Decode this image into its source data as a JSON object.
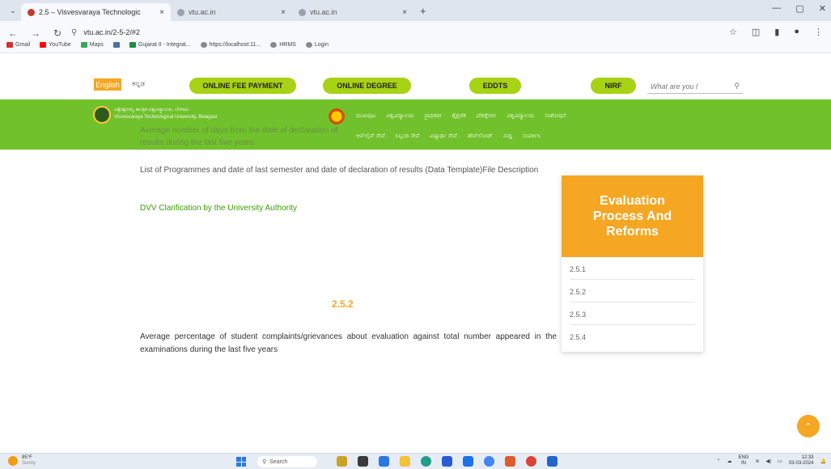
{
  "browser": {
    "tabs": [
      {
        "title": "2.5 – Visvesvaraya Technologic",
        "active": true
      },
      {
        "title": "vtu.ac.in",
        "active": false
      },
      {
        "title": "vtu.ac.in",
        "active": false
      }
    ],
    "url": "vtu.ac.in/2-5-2/#2",
    "bookmarks": [
      "Gmail",
      "YouTube",
      "Maps",
      "",
      "Gujarat II - Integrat...",
      "https://localhost:11...",
      "HRMS",
      "Login"
    ]
  },
  "site": {
    "lang_en": "English",
    "lang_kn": "ಕನ್ನಡ",
    "pills": [
      "ONLINE FEE PAYMENT",
      "ONLINE DEGREE",
      "EDDTS",
      "NIRF"
    ],
    "search_placeholder": "What are you l",
    "uni_name_kn": "ವಿಶ್ವೇಶ್ವರಯ್ಯ ತಾಂತ್ರಿಕ ವಿಶ್ವವಿದ್ಯಾಲಯ, ಬೆಳಗಾವಿ",
    "uni_name_en": "Visvesvaraya Technological University, Belagavi",
    "menu_row1": [
      "ಮುಖಪುಟ",
      "ವಿಶ್ವವಿದ್ಯಾಲಯ",
      "ಪ್ರಾಧಿಕಾರ",
      "ಶೈಕ್ಷಣಿಕ",
      "ಪರೀಕ್ಷೆಗಳು",
      "ವಿಶ್ವವಿದ್ಯಾಲಯ",
      "ಸಂಶೋಧನೆ"
    ],
    "menu_row2": [
      "ಆನ್‌ಲೈನ್ ಸೇವೆ",
      "ಸಿಬ್ಬಂದಿ ಸೇವೆ",
      "ವಿದ್ಯಾರ್ಥಿ ಸೇವೆ",
      "ಡೌನ್‌ಲೋಡ್",
      "ಸುದ್ದಿ",
      "ಸಂಪರ್ಕಿಸಿ"
    ]
  },
  "content": {
    "ghost_text": "Average number of days from the date of declaration of results during the last five years",
    "description": "List of Programmes and date of last semester and date of declaration of results (Data Template)File Description",
    "dvv_link": "DVV Clarification by the University Authority",
    "section_heading": "2.5.2",
    "paragraph": "Average percentage of student complaints/grievances about evaluation against total number appeared in the examinations during the last five years"
  },
  "sidebar": {
    "title": "Evaluation Process And Reforms",
    "items": [
      "2.5.1",
      "2.5.2",
      "2.5.3",
      "2.5.4"
    ]
  },
  "taskbar": {
    "weather_temp": "85°F",
    "weather_desc": "Sunny",
    "search_label": "Search",
    "lang_top": "ENG",
    "lang_bottom": "IN",
    "time": "12:33",
    "date": "03-03-2024"
  },
  "colors": {
    "accent_orange": "#f5a623",
    "nav_green": "#71c12c",
    "pill_green": "#a8d214",
    "link_green": "#3aa000"
  }
}
